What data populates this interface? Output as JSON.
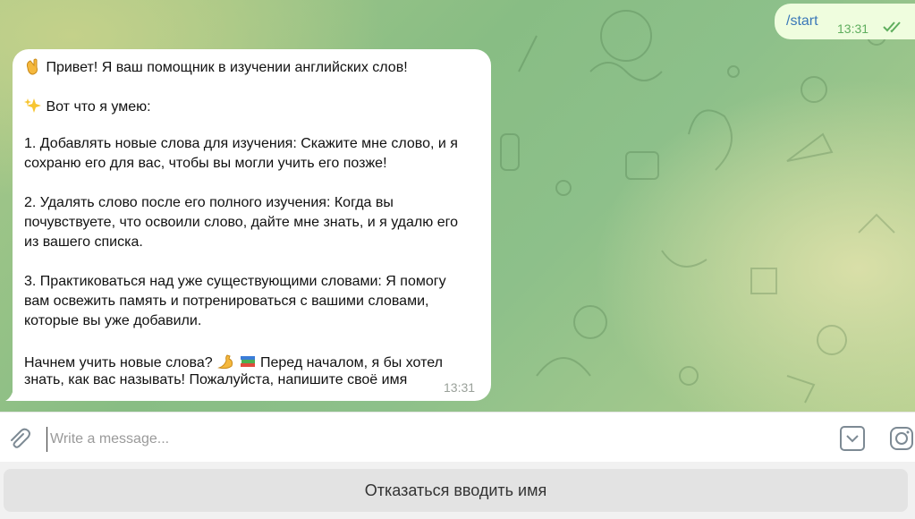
{
  "chat": {
    "outgoing": {
      "text": "/start",
      "time": "13:31",
      "status": "read"
    },
    "incoming": {
      "lines": [
        {
          "emoji": "wave-icon",
          "text": "Привет! Я ваш помощник в изучении английских слов!"
        },
        {
          "emoji": "sparkles-icon",
          "text": "Вот что я умею:"
        },
        {
          "text": "1. Добавлять новые слова для изучения: Скажите мне слово, и я"
        },
        {
          "text": "сохраню его для вас, чтобы вы могли учить его позже!"
        },
        {
          "text": "2. Удалять слово после его полного изучения: Когда вы"
        },
        {
          "text": "почувствуете, что освоили слово, дайте мне знать, и я удалю его"
        },
        {
          "text": "из вашего списка."
        },
        {
          "text": "3. Практиковаться над уже существующими словами: Я помогу"
        },
        {
          "text": "вам освежить память и потренироваться с вашими словами,"
        },
        {
          "text": "которые вы уже добавили."
        },
        {
          "text": "Начнем учить новые слова?",
          "after": "Перед началом, я бы хотел"
        },
        {
          "text": "знать, как вас называть! Пожалуйста, напишите своё имя"
        }
      ],
      "time": "13:31"
    }
  },
  "composer": {
    "placeholder": "Write a message...",
    "value": "",
    "attach_icon": "paperclip-icon",
    "keyboard_icon": "bot-keyboard-icon",
    "camera_icon": "instagram-camera-icon"
  },
  "reply_keyboard": {
    "button_label": "Отказаться вводить имя"
  },
  "colors": {
    "outgoing_bubble": "#effdde",
    "link": "#3a78b8",
    "check": "#5fae5e",
    "incoming_bubble": "#ffffff"
  }
}
